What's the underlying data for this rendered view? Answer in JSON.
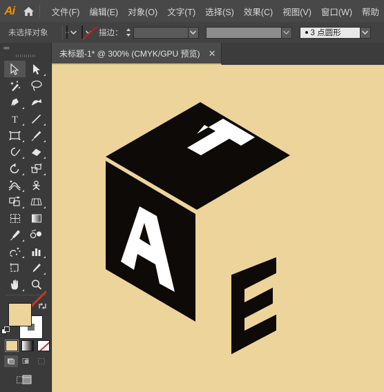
{
  "app": {
    "name": "Adobe Illustrator",
    "logo_text": "Ai",
    "accent_color": "#f29100",
    "chrome_color": "#484848",
    "canvas_color": "#edd49b"
  },
  "menubar": {
    "home_icon": "home-icon",
    "items": [
      {
        "label": "文件(F)"
      },
      {
        "label": "编辑(E)"
      },
      {
        "label": "对象(O)"
      },
      {
        "label": "文字(T)"
      },
      {
        "label": "选择(S)"
      },
      {
        "label": "效果(C)"
      },
      {
        "label": "视图(V)"
      },
      {
        "label": "窗口(W)"
      },
      {
        "label": "帮助"
      }
    ]
  },
  "controlbar": {
    "selection_status": "未选择对象",
    "fill_color": "#edd49b",
    "fill_caret": "chevron-down-icon",
    "stroke_value": "无",
    "stroke_caret": "chevron-down-icon",
    "stroke_label": "描边：",
    "stroke_weight_value": "",
    "stroke_weight_caret": "chevron-down-icon",
    "stroke_profile_value": "",
    "stroke_profile_caret": "chevron-down-icon",
    "brush_definition": "3 点圆形",
    "brush_caret": "chevron-down-icon"
  },
  "tabbar": {
    "document_title": "未标题-1* @ 300% (CMYK/GPU 预览)",
    "close_glyph": "✕"
  },
  "toolpanel": {
    "collapse_glyph": "««",
    "tools": [
      {
        "name": "selection-tool",
        "active": true,
        "corner": false
      },
      {
        "name": "direct-selection-tool",
        "active": false,
        "corner": true
      },
      {
        "name": "magic-wand-tool",
        "active": false,
        "corner": false
      },
      {
        "name": "lasso-tool",
        "active": false,
        "corner": false
      },
      {
        "name": "pen-tool",
        "active": false,
        "corner": true
      },
      {
        "name": "curvature-tool",
        "active": false,
        "corner": false
      },
      {
        "name": "type-tool",
        "active": false,
        "corner": true
      },
      {
        "name": "line-segment-tool",
        "active": false,
        "corner": true
      },
      {
        "name": "rectangle-tool",
        "active": false,
        "corner": true
      },
      {
        "name": "paintbrush-tool",
        "active": false,
        "corner": true
      },
      {
        "name": "shaper-tool",
        "active": false,
        "corner": true
      },
      {
        "name": "eraser-tool",
        "active": false,
        "corner": true
      },
      {
        "name": "rotate-tool",
        "active": false,
        "corner": true
      },
      {
        "name": "scale-tool",
        "active": false,
        "corner": true
      },
      {
        "name": "width-tool",
        "active": false,
        "corner": true
      },
      {
        "name": "free-transform-tool",
        "active": false,
        "corner": false
      },
      {
        "name": "shape-builder-tool",
        "active": false,
        "corner": true
      },
      {
        "name": "perspective-grid-tool",
        "active": false,
        "corner": true
      },
      {
        "name": "mesh-tool",
        "active": false,
        "corner": false
      },
      {
        "name": "gradient-tool",
        "active": false,
        "corner": false
      },
      {
        "name": "eyedropper-tool",
        "active": false,
        "corner": true
      },
      {
        "name": "blend-tool",
        "active": false,
        "corner": false
      },
      {
        "name": "symbol-sprayer-tool",
        "active": false,
        "corner": true
      },
      {
        "name": "column-graph-tool",
        "active": false,
        "corner": true
      },
      {
        "name": "artboard-tool",
        "active": false,
        "corner": false
      },
      {
        "name": "slice-tool",
        "active": false,
        "corner": true
      },
      {
        "name": "hand-tool",
        "active": false,
        "corner": true
      },
      {
        "name": "zoom-tool",
        "active": false,
        "corner": false
      }
    ],
    "fill_color": "#edd49b",
    "stroke_color": "none",
    "swap_icon": "swap-fill-stroke-icon",
    "default_icon": "default-fill-stroke-icon",
    "color_modes": [
      {
        "name": "color-mode-flat",
        "selected": true
      },
      {
        "name": "color-mode-gradient",
        "selected": false
      },
      {
        "name": "color-mode-none",
        "selected": false
      }
    ],
    "draw_modes": [
      {
        "name": "draw-normal-mode",
        "selected": true
      },
      {
        "name": "draw-behind-mode",
        "selected": false
      },
      {
        "name": "draw-inside-mode",
        "selected": false
      }
    ],
    "screen_mode": "change-screen-mode-icon"
  },
  "artwork": {
    "description": "isometric black cube with white letters",
    "cube_color": "#0d0a08",
    "letter_color": "#ffffff",
    "background": "#edd49b",
    "letters": [
      {
        "face": "top",
        "char": "T",
        "color": "#ffffff"
      },
      {
        "face": "left",
        "char": "A",
        "color": "#ffffff"
      },
      {
        "face": "right",
        "char": "E",
        "color": "#0d0a08"
      }
    ]
  }
}
